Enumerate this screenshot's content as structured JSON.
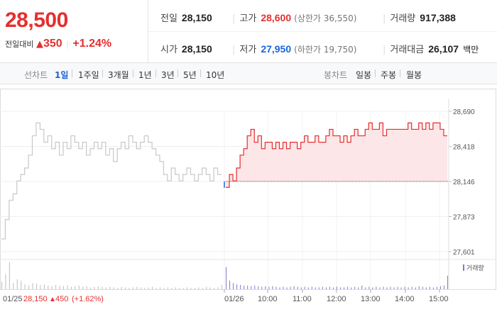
{
  "price": {
    "current": "28,500",
    "change_label": "전일대비",
    "change_arrow": "▲",
    "change_value": "350",
    "change_pct": "+1.24%"
  },
  "stats": {
    "prev_close": {
      "label": "전일",
      "value": "28,150"
    },
    "high": {
      "label": "고가",
      "value": "28,600",
      "limit_label": "(상한가 36,550)"
    },
    "volume": {
      "label": "거래량",
      "value": "917,388"
    },
    "open": {
      "label": "시가",
      "value": "28,150"
    },
    "low": {
      "label": "저가",
      "value": "27,950",
      "limit_label": "(하한가 19,750)"
    },
    "amount": {
      "label": "거래대금",
      "value": "26,107",
      "unit": "백만"
    }
  },
  "toolbar": {
    "line_chart_label": "선차트",
    "periods": [
      "1일",
      "1주일",
      "3개월",
      "1년",
      "3년",
      "5년",
      "10년"
    ],
    "active_period": "1일",
    "candle_chart_label": "봉차트",
    "candles": [
      "일봉",
      "주봉",
      "월봉"
    ]
  },
  "colors": {
    "up": "#e52f2f",
    "down": "#1b64da",
    "prev_day_line": "#c8c8c8",
    "fill": "#fde3e4",
    "volume": "#8a78c6"
  },
  "chart_data": {
    "type": "line",
    "title": "",
    "y_ticks": [
      "28,690",
      "28,418",
      "28,146",
      "27,873",
      "27,601"
    ],
    "ylim": [
      27601,
      28690
    ],
    "baseline": 28146,
    "x_ticks": [
      "01/25",
      "01/26",
      "10:00",
      "11:00",
      "12:00",
      "13:00",
      "14:00",
      "15:00"
    ],
    "prev_day_summary": {
      "date": "01/25",
      "close": "28,150",
      "arrow": "▲",
      "change": "450",
      "pct": "(+1.62%)"
    },
    "volume_label": "거래량",
    "series": [
      {
        "values": [
          27700,
          27850,
          28000,
          28050,
          28150,
          28200,
          28250,
          28350,
          28500,
          28600,
          28550,
          28450,
          28500,
          28400,
          28450,
          28350,
          28450,
          28400,
          28500,
          28450,
          28400,
          28450,
          28350,
          28400,
          28450,
          28400,
          28450,
          28350,
          28400,
          28300,
          28400,
          28450,
          28400,
          28500,
          28450,
          28400,
          28450,
          28500,
          28450,
          28400,
          28350,
          28300,
          28200,
          28150,
          28250,
          28200,
          28150,
          28200,
          28250,
          28200,
          28150,
          28200,
          28250,
          28200,
          28150,
          28250,
          28200,
          28200
        ]
      },
      {
        "values": [
          28100,
          28200,
          28150,
          28250,
          28350,
          28400,
          28500,
          28550,
          28450,
          28500,
          28400,
          28450,
          28450,
          28400,
          28450,
          28400,
          28450,
          28400,
          28450,
          28450,
          28400,
          28450,
          28500,
          28450,
          28450,
          28500,
          28450,
          28450,
          28500,
          28550,
          28500,
          28500,
          28450,
          28500,
          28450,
          28500,
          28550,
          28500,
          28500,
          28550,
          28600,
          28550,
          28550,
          28600,
          28500,
          28550,
          28550,
          28550,
          28550,
          28550,
          28550,
          28600,
          28550,
          28550,
          28600,
          28550,
          28600,
          28550,
          28600,
          28600,
          28550,
          28500,
          28500
        ]
      }
    ],
    "volume": {
      "prev_day": [
        600,
        1200,
        2200,
        500,
        800,
        700,
        400,
        300,
        500,
        450,
        350,
        400,
        300,
        250,
        350,
        300,
        250,
        300,
        200,
        250,
        300,
        200,
        250,
        150,
        200,
        250,
        200,
        150,
        200,
        150,
        100,
        200,
        150,
        100,
        150,
        200,
        150,
        100,
        150,
        200,
        100,
        150,
        100,
        150,
        100,
        150,
        100,
        100,
        150,
        100,
        100,
        150,
        100,
        200,
        150,
        100,
        150,
        350
      ],
      "today": [
        1800,
        700,
        500,
        400,
        350,
        300,
        300,
        250,
        300,
        250,
        200,
        250,
        200,
        250,
        200,
        150,
        200,
        150,
        200,
        250,
        200,
        150,
        200,
        150,
        200,
        150,
        150,
        200,
        150,
        200,
        150,
        200,
        150,
        150,
        200,
        150,
        200,
        150,
        300,
        150,
        200,
        150,
        200,
        150,
        200,
        150,
        200,
        150,
        200,
        150,
        200,
        150,
        200,
        150,
        250,
        200,
        150,
        200,
        150,
        200,
        250,
        300,
        1100
      ]
    }
  }
}
